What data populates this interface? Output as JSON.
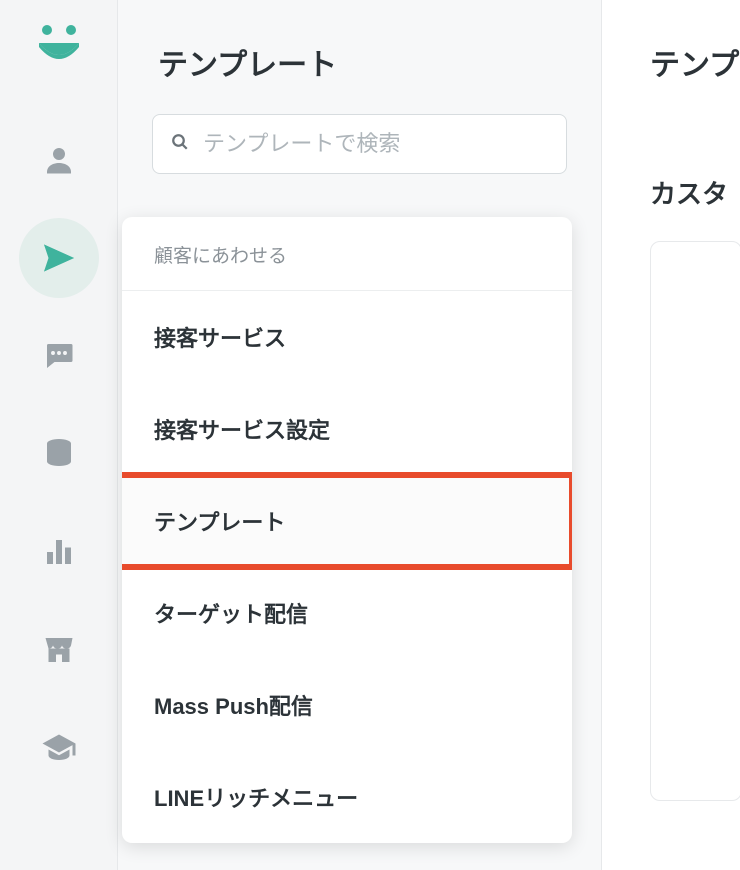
{
  "sidebar": {
    "icons": [
      {
        "name": "logo-icon"
      },
      {
        "name": "person-icon"
      },
      {
        "name": "send-icon",
        "active": true
      },
      {
        "name": "chat-icon"
      },
      {
        "name": "database-icon"
      },
      {
        "name": "chart-icon"
      },
      {
        "name": "store-icon"
      },
      {
        "name": "graduation-icon"
      }
    ]
  },
  "panel": {
    "title": "テンプレート",
    "search_placeholder": "テンプレートで検索"
  },
  "flyout": {
    "header": "顧客にあわせる",
    "items": [
      {
        "label": "接客サービス"
      },
      {
        "label": "接客サービス設定"
      },
      {
        "label": "テンプレート",
        "highlighted": true
      },
      {
        "label": "ターゲット配信"
      },
      {
        "label": "Mass Push配信"
      },
      {
        "label": "LINEリッチメニュー"
      }
    ]
  },
  "right": {
    "title": "テンプ",
    "subtitle": "カスタ"
  }
}
